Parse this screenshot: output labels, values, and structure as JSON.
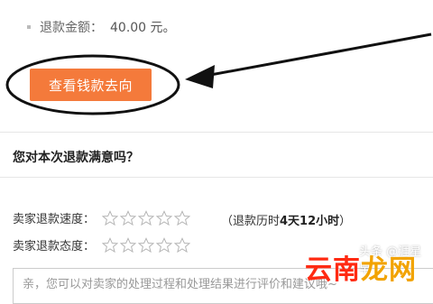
{
  "refund": {
    "label": "退款金额：",
    "amount": "40.00 元。"
  },
  "actions": {
    "view_money_flow": "查看钱款去向"
  },
  "satisfaction": {
    "title": "您对本次退款满意吗？",
    "ratings": [
      {
        "label": "卖家退款速度：",
        "stars_max": 5,
        "stars_filled": 0
      },
      {
        "label": "卖家退款态度：",
        "stars_max": 5,
        "stars_filled": 0
      }
    ],
    "duration_prefix": "（退款历时",
    "duration_value": "4天12小时",
    "duration_suffix": "）"
  },
  "comment": {
    "placeholder": "亲，您可以对卖家的处理过程和处理结果进行评价和建议哦~"
  },
  "overlay": {
    "watermark": "头条 @涯星早",
    "brand_main": "云南",
    "brand_tail": "龙网"
  },
  "colors": {
    "button_bg": "#f47a3b",
    "brand": "#ff2a12"
  }
}
